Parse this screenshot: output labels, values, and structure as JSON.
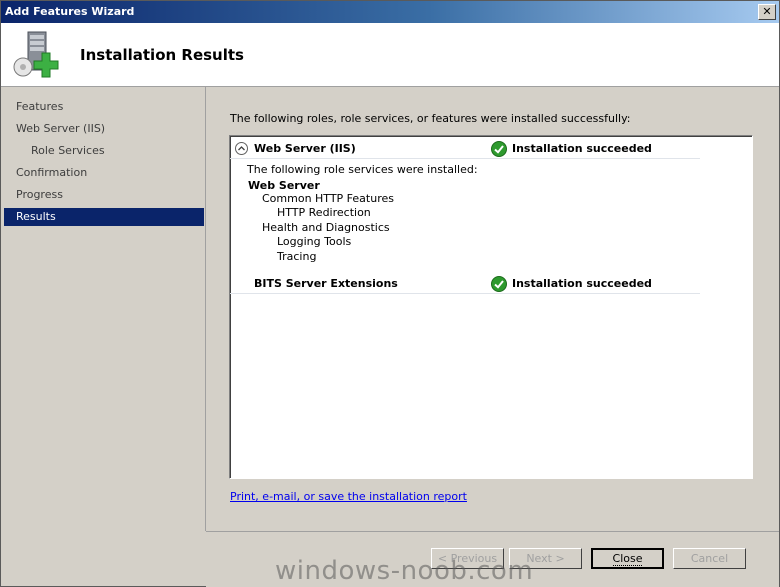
{
  "window": {
    "title": "Add Features Wizard",
    "close_glyph": "✕"
  },
  "header": {
    "heading": "Installation Results",
    "icon": "server-add-icon"
  },
  "sidebar": {
    "items": [
      {
        "label": "Features"
      },
      {
        "label": "Web Server (IIS)"
      },
      {
        "label": "Role Services"
      },
      {
        "label": "Confirmation"
      },
      {
        "label": "Progress"
      },
      {
        "label": "Results",
        "selected": true
      }
    ]
  },
  "content": {
    "intro": "The following roles, role services, or features were installed successfully:",
    "results": [
      {
        "name": "Web Server (IIS)",
        "status": "Installation succeeded",
        "detail_intro": "The following role services were installed:",
        "group": "Web Server",
        "services": [
          "Common HTTP Features",
          "HTTP Redirection",
          "Health and Diagnostics",
          "Logging Tools",
          "Tracing"
        ]
      },
      {
        "name": "BITS Server Extensions",
        "status": "Installation succeeded"
      }
    ],
    "report_link": "Print, e-mail, or save the installation report"
  },
  "buttons": {
    "previous": "< Previous",
    "next": "Next >",
    "close": "Close",
    "cancel": "Cancel"
  },
  "watermark": "windows-noob.com",
  "colors": {
    "selected": "#0a246a",
    "success": "#2e9a2e",
    "link": "#0000ee"
  }
}
